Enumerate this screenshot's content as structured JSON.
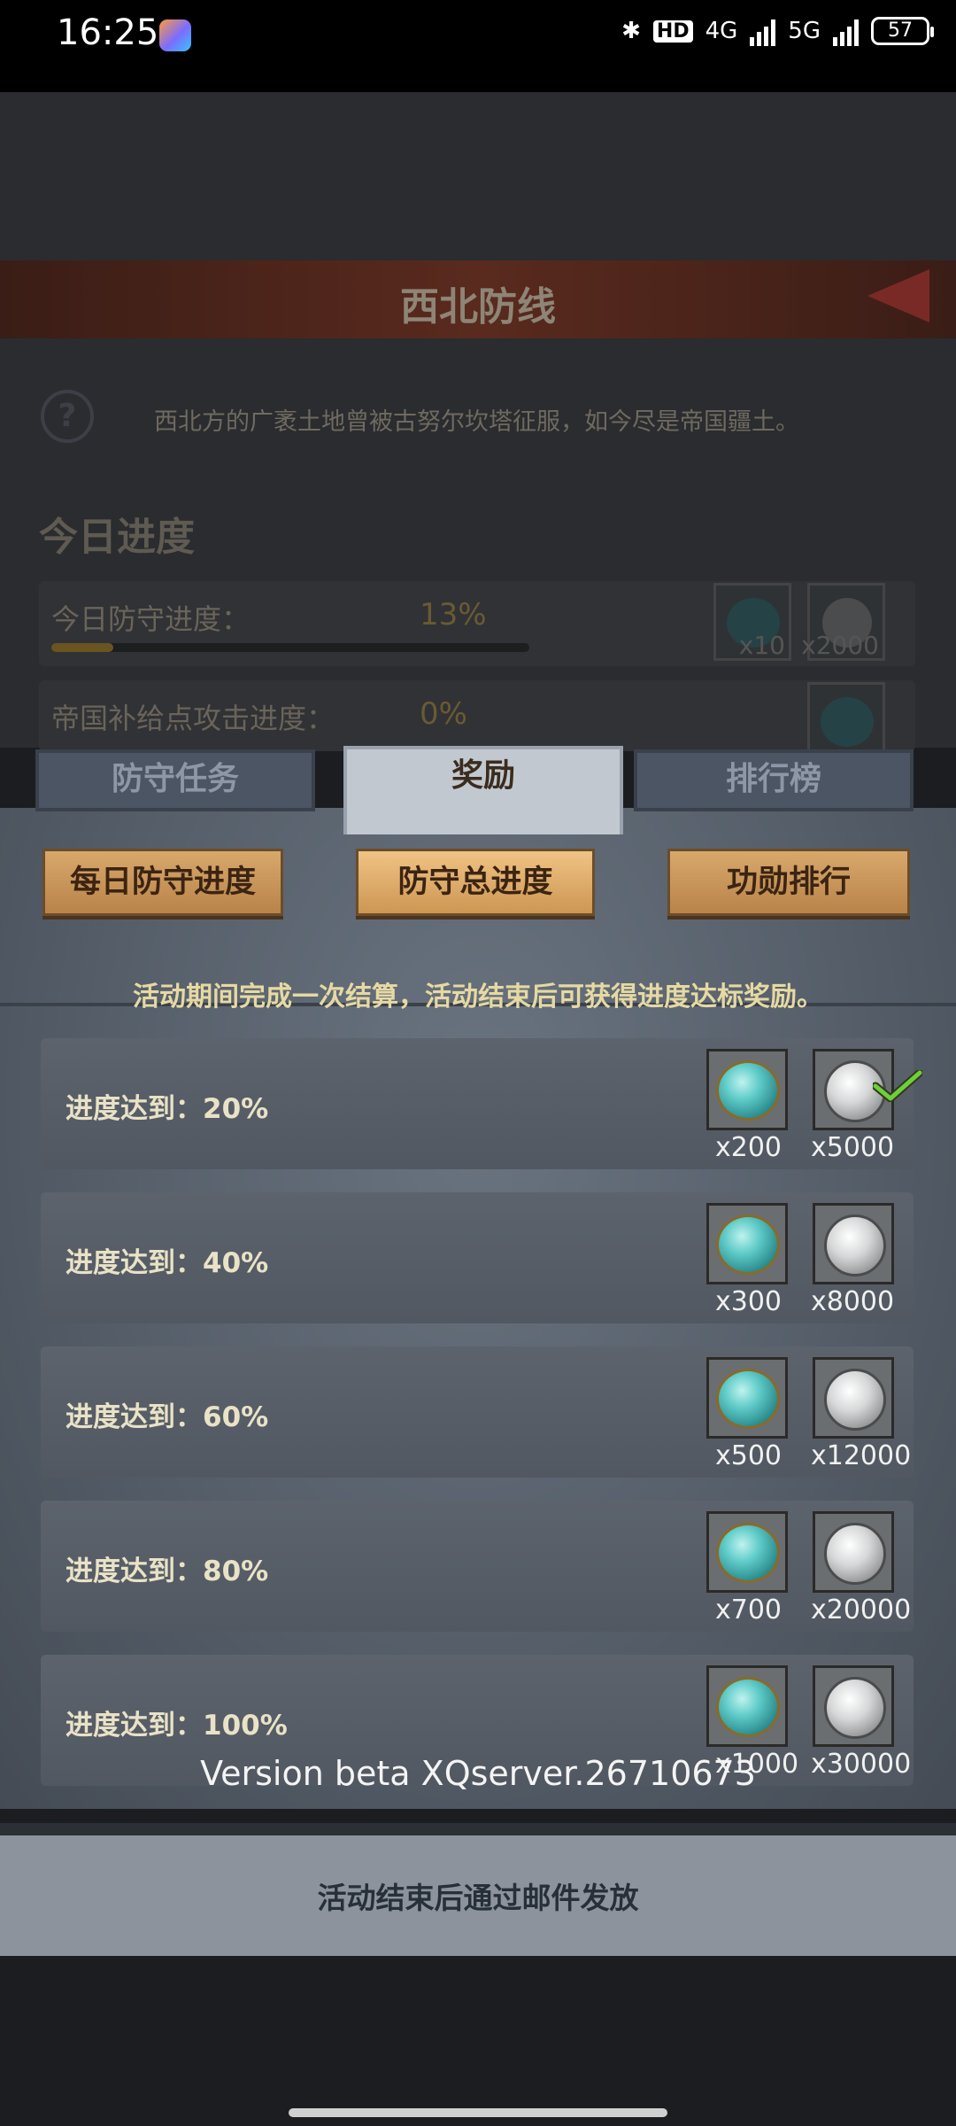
{
  "status_bar": {
    "time": "16:25",
    "network_label": "HD",
    "network_4g": "4G",
    "network_5g": "5G",
    "battery": "57"
  },
  "background_layer": {
    "title": "西北防线",
    "description": "西北方的广袤土地曾被古努尔坎塔征服，如今尽是帝国疆土。",
    "section_title": "今日进度",
    "rows": [
      {
        "label": "今日防守进度：",
        "percent": "13%",
        "progress": 0.13,
        "rewards": [
          "x10",
          "x2000"
        ]
      },
      {
        "label": "帝国补给点攻击进度：",
        "percent": "0%",
        "progress": 0,
        "rewards": []
      }
    ]
  },
  "tabs": [
    {
      "label": "防守任务",
      "active": false
    },
    {
      "label": "奖励",
      "active": true
    },
    {
      "label": "排行榜",
      "active": false
    }
  ],
  "sub_tabs": [
    {
      "label": "每日防守进度",
      "active": false
    },
    {
      "label": "防守总进度",
      "active": true
    },
    {
      "label": "功勋排行",
      "active": false
    }
  ],
  "hint": "活动期间完成一次结算，活动结束后可获得进度达标奖励。",
  "reward_rows": [
    {
      "label": "进度达到：20%",
      "gem_qty": "x200",
      "coin_qty": "x5000",
      "claimed": true
    },
    {
      "label": "进度达到：40%",
      "gem_qty": "x300",
      "coin_qty": "x8000",
      "claimed": false
    },
    {
      "label": "进度达到：60%",
      "gem_qty": "x500",
      "coin_qty": "x12000",
      "claimed": false
    },
    {
      "label": "进度达到：80%",
      "gem_qty": "x700",
      "coin_qty": "x20000",
      "claimed": false
    },
    {
      "label": "进度达到：100%",
      "gem_qty": "x1000",
      "coin_qty": "x30000",
      "claimed": false
    }
  ],
  "version": "Version beta XQserver.26710673",
  "footer": "活动结束后通过邮件发放"
}
